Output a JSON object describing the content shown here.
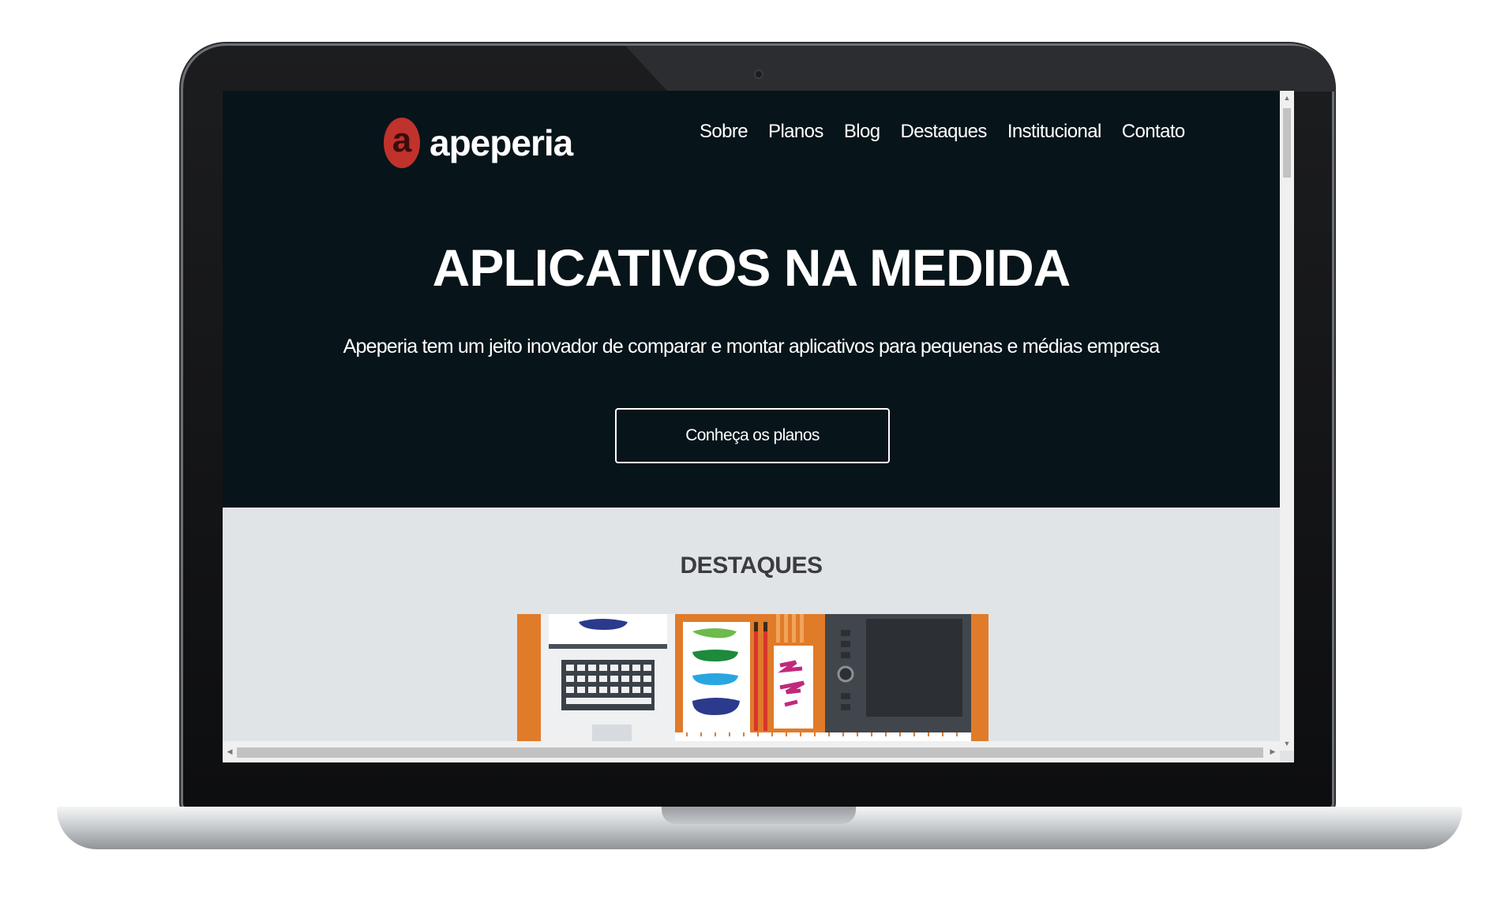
{
  "brand": {
    "logo_letter": "a",
    "name": "apeperia",
    "logo_color": "#c0322c"
  },
  "nav": {
    "items": [
      {
        "label": "Sobre"
      },
      {
        "label": "Planos"
      },
      {
        "label": "Blog"
      },
      {
        "label": "Destaques"
      },
      {
        "label": "Institucional"
      },
      {
        "label": "Contato"
      }
    ]
  },
  "hero": {
    "title": "APLICATIVOS NA MEDIDA",
    "subtitle": "Apeperia tem um jeito inovador de comparar e montar aplicativos para pequenas e médias empresa",
    "cta_label": "Conheça os planos",
    "background": "#07141a"
  },
  "features": {
    "title": "DESTAQUES",
    "image_icon": "designer-desk-illustration",
    "image_accent": "#e07b2a",
    "background": "#e1e4e7"
  },
  "scrollbars": {
    "up_icon": "▲",
    "down_icon": "▼",
    "left_icon": "◀",
    "right_icon": "▶"
  }
}
